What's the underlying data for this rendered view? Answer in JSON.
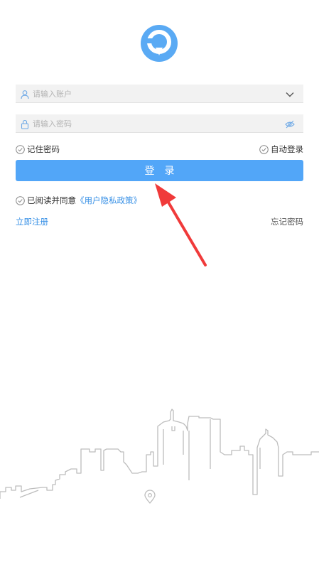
{
  "colors": {
    "accent": "#52a6f8",
    "link": "#3790e6",
    "arrow": "#f03a3a",
    "skyline": "#bdbdbd"
  },
  "logo": {
    "icon": "location-pin-logo-icon"
  },
  "form": {
    "account": {
      "placeholder": "请输入账户",
      "value": "",
      "icon": "user-icon",
      "trailing_icon": "chevron-down-icon"
    },
    "password": {
      "placeholder": "请输入密码",
      "value": "",
      "icon": "lock-icon",
      "trailing_icon": "eye-icon"
    }
  },
  "options": {
    "remember_label": "记住密码",
    "auto_login_label": "自动登录"
  },
  "login_button_label": "登录",
  "agreement": {
    "text": "已阅读并同意",
    "policy_link": "《用户隐私政策》"
  },
  "links": {
    "register": "立即注册",
    "forgot": "忘记密码"
  }
}
